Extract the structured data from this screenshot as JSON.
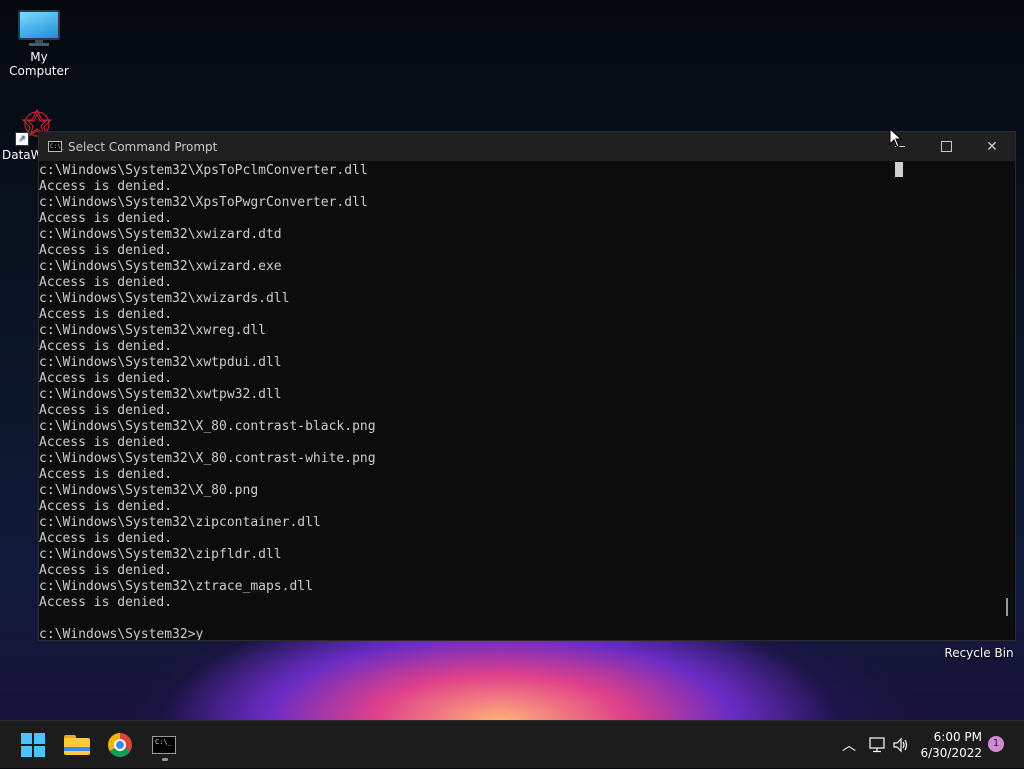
{
  "desktop": {
    "icons": [
      {
        "label": "My Computer"
      },
      {
        "label": "DataW"
      }
    ],
    "recycle_bin_label": "Recycle Bin"
  },
  "window": {
    "title": "Select Command Prompt",
    "icon_text": "C:\\_",
    "console_lines": [
      "c:\\Windows\\System32\\XpsToPclmConverter.dll",
      "Access is denied.",
      "c:\\Windows\\System32\\XpsToPwgrConverter.dll",
      "Access is denied.",
      "c:\\Windows\\System32\\xwizard.dtd",
      "Access is denied.",
      "c:\\Windows\\System32\\xwizard.exe",
      "Access is denied.",
      "c:\\Windows\\System32\\xwizards.dll",
      "Access is denied.",
      "c:\\Windows\\System32\\xwreg.dll",
      "Access is denied.",
      "c:\\Windows\\System32\\xwtpdui.dll",
      "Access is denied.",
      "c:\\Windows\\System32\\xwtpw32.dll",
      "Access is denied.",
      "c:\\Windows\\System32\\X_80.contrast-black.png",
      "Access is denied.",
      "c:\\Windows\\System32\\X_80.contrast-white.png",
      "Access is denied.",
      "c:\\Windows\\System32\\X_80.png",
      "Access is denied.",
      "c:\\Windows\\System32\\zipcontainer.dll",
      "Access is denied.",
      "c:\\Windows\\System32\\zipfldr.dll",
      "Access is denied.",
      "c:\\Windows\\System32\\ztrace_maps.dll",
      "Access is denied.",
      "",
      "c:\\Windows\\System32>y"
    ],
    "close_glyph": "✕"
  },
  "taskbar": {
    "cmd_icon_text": "C:\\_",
    "chevron_glyph": "︿",
    "time": "6:00 PM",
    "date": "6/30/2022",
    "notification_count": "1"
  }
}
